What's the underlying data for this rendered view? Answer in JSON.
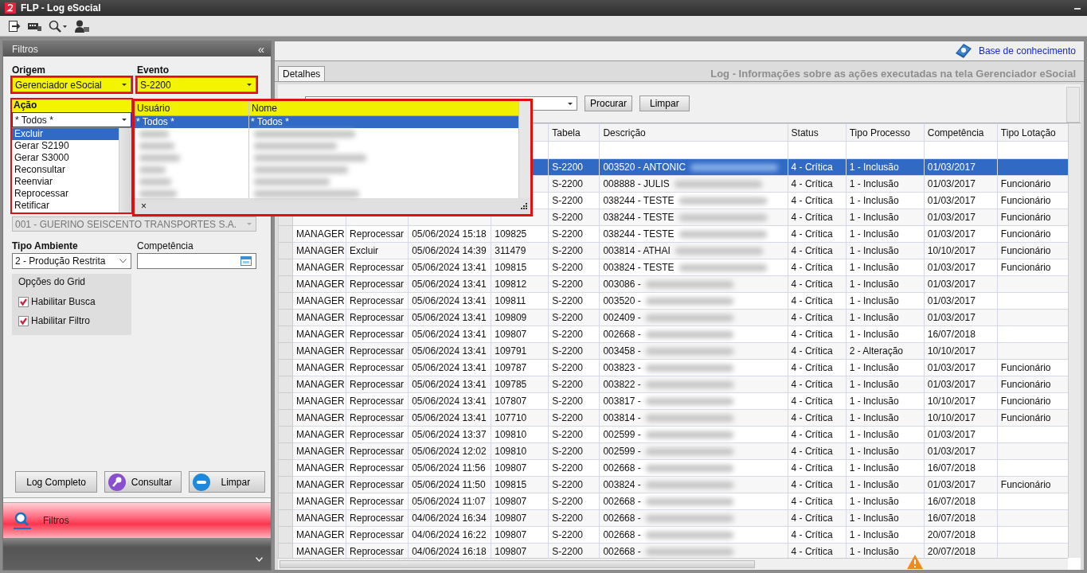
{
  "window": {
    "title": "FLP - Log eSocial"
  },
  "filters_panel": {
    "title": "Filtros",
    "collapse": "«",
    "origem": {
      "label": "Origem",
      "value": "Gerenciador eSocial",
      "highlighted": true
    },
    "evento": {
      "label": "Evento",
      "value": "S-2200",
      "highlighted": true
    },
    "acao": {
      "label": "Ação",
      "value": "* Todos *",
      "highlighted": true,
      "expanded": true,
      "options": [
        {
          "label": "Excluir",
          "selected": true
        },
        {
          "label": "Gerar S2190",
          "selected": false
        },
        {
          "label": "Gerar S3000",
          "selected": false
        },
        {
          "label": "Reconsultar",
          "selected": false
        },
        {
          "label": "Reenviar",
          "selected": false
        },
        {
          "label": "Reprocessar",
          "selected": false
        },
        {
          "label": "Retificar",
          "selected": false
        }
      ]
    },
    "empresa": {
      "value": "001 - GUERINO SEISCENTO TRANSPORTES S.A.",
      "disabled": true
    },
    "usuario_popup": {
      "highlighted": true,
      "columns": [
        "Usuário",
        "Nome"
      ],
      "rows": [
        {
          "usuario": "* Todos *",
          "nome": "* Todos *",
          "selected": true
        }
      ],
      "clear": "×"
    },
    "tipo_ambiente": {
      "label": "Tipo Ambiente",
      "value": "2 - Produção Restrita"
    },
    "competencia": {
      "label": "Competência"
    },
    "grid_options": {
      "title": "Opções do Grid",
      "options": [
        {
          "label": "Habilitar Busca",
          "checked": true
        },
        {
          "label": "Habilitar Filtro",
          "checked": true
        }
      ]
    },
    "buttons": [
      "Log Completo",
      "Consultar",
      "Limpar"
    ]
  },
  "nav": {
    "label": "Filtros",
    "selected": true
  },
  "help_link": "Base de conhecimento",
  "tabs": [
    {
      "label": "Detalhes",
      "selected": true
    }
  ],
  "page_title": "Log - Informações sobre as ações executadas na tela Gerenciador eSocial",
  "search": {
    "buttons": [
      "Procurar",
      "Limpar"
    ]
  },
  "table": {
    "columns": [
      "Tabela",
      "Descrição",
      "Status",
      "Tipo Processo",
      "Competência",
      "Tipo Lotação"
    ],
    "rows": [
      {
        "selected": true,
        "blurred": true,
        "tabela": "S-2200",
        "descricao": "003520 - ANTONIC",
        "status": "4 - Crítica",
        "tipo_processo": "1 - Inclusão",
        "competencia": "01/03/2017"
      },
      {
        "selected": false,
        "blurred": true,
        "tabela": "S-2200",
        "descricao": "008888 - JULIS",
        "status": "4 - Crítica",
        "tipo_processo": "1 - Inclusão",
        "competencia": "01/03/2017",
        "tipo_lotacao": "Funcionário"
      },
      {
        "selected": false,
        "blurred": true,
        "tabela": "S-2200",
        "descricao": "038244 - TESTE",
        "status": "4 - Crítica",
        "tipo_processo": "1 - Inclusão",
        "competencia": "01/03/2017",
        "tipo_lotacao": "Funcionário"
      },
      {
        "selected": false,
        "blurred": true,
        "tabela": "S-2200",
        "descricao": "038244 - TESTE",
        "status": "4 - Crítica",
        "tipo_processo": "1 - Inclusão",
        "competencia": "01/03/2017",
        "tipo_lotacao": "Funcionário"
      },
      {
        "selected": false,
        "blurred": true,
        "column_1": "MANAGER",
        "column_2": "Reprocessar",
        "column_3": "05/06/2024 15:18",
        "column_4": "109825",
        "tabela": "S-2200",
        "descricao": "038244 - TESTE",
        "status": "4 - Crítica",
        "tipo_processo": "1 - Inclusão",
        "competencia": "01/03/2017",
        "tipo_lotacao": "Funcionário"
      },
      {
        "selected": false,
        "blurred": true,
        "column_1": "MANAGER",
        "column_2": "Excluir",
        "column_3": "05/06/2024 14:39",
        "column_4": "311479",
        "tabela": "S-2200",
        "descricao": "003814 - ATHAI",
        "status": "4 - Crítica",
        "tipo_processo": "1 - Inclusão",
        "competencia": "10/10/2017",
        "tipo_lotacao": "Funcionário"
      },
      {
        "selected": false,
        "blurred": true,
        "column_1": "MANAGER",
        "column_2": "Reprocessar",
        "column_3": "05/06/2024 13:41",
        "column_4": "109815",
        "tabela": "S-2200",
        "descricao": "003824 - TESTE",
        "status": "4 - Crítica",
        "tipo_processo": "1 - Inclusão",
        "competencia": "01/03/2017",
        "tipo_lotacao": "Funcionário"
      },
      {
        "selected": false,
        "blurred": true,
        "column_1": "MANAGER",
        "column_2": "Reprocessar",
        "column_3": "05/06/2024 13:41",
        "column_4": "109812",
        "tabela": "S-2200",
        "descricao": "003086 -",
        "status": "4 - Crítica",
        "tipo_processo": "1 - Inclusão",
        "competencia": "01/03/2017"
      },
      {
        "selected": false,
        "blurred": true,
        "column_1": "MANAGER",
        "column_2": "Reprocessar",
        "column_3": "05/06/2024 13:41",
        "column_4": "109811",
        "tabela": "S-2200",
        "descricao": "003520 -",
        "status": "4 - Crítica",
        "tipo_processo": "1 - Inclusão",
        "competencia": "01/03/2017"
      },
      {
        "selected": false,
        "blurred": true,
        "column_1": "MANAGER",
        "column_2": "Reprocessar",
        "column_3": "05/06/2024 13:41",
        "column_4": "109809",
        "tabela": "S-2200",
        "descricao": "002409 -",
        "status": "4 - Crítica",
        "tipo_processo": "1 - Inclusão",
        "competencia": "01/03/2017"
      },
      {
        "selected": false,
        "blurred": true,
        "column_1": "MANAGER",
        "column_2": "Reprocessar",
        "column_3": "05/06/2024 13:41",
        "column_4": "109807",
        "tabela": "S-2200",
        "descricao": "002668 -",
        "status": "4 - Crítica",
        "tipo_processo": "1 - Inclusão",
        "competencia": "16/07/2018"
      },
      {
        "selected": false,
        "blurred": true,
        "column_1": "MANAGER",
        "column_2": "Reprocessar",
        "column_3": "05/06/2024 13:41",
        "column_4": "109791",
        "tabela": "S-2200",
        "descricao": "003458 -",
        "status": "4 - Crítica",
        "tipo_processo": "2 - Alteração",
        "competencia": "10/10/2017"
      },
      {
        "selected": false,
        "blurred": true,
        "column_1": "MANAGER",
        "column_2": "Reprocessar",
        "column_3": "05/06/2024 13:41",
        "column_4": "109787",
        "tabela": "S-2200",
        "descricao": "003823 -",
        "status": "4 - Crítica",
        "tipo_processo": "1 - Inclusão",
        "competencia": "01/03/2017",
        "tipo_lotacao": "Funcionário"
      },
      {
        "selected": false,
        "blurred": true,
        "column_1": "MANAGER",
        "column_2": "Reprocessar",
        "column_3": "05/06/2024 13:41",
        "column_4": "109785",
        "tabela": "S-2200",
        "descricao": "003822 -",
        "status": "4 - Crítica",
        "tipo_processo": "1 - Inclusão",
        "competencia": "01/03/2017",
        "tipo_lotacao": "Funcionário"
      },
      {
        "selected": false,
        "blurred": true,
        "column_1": "MANAGER",
        "column_2": "Reprocessar",
        "column_3": "05/06/2024 13:41",
        "column_4": "107807",
        "tabela": "S-2200",
        "descricao": "003817 -",
        "status": "4 - Crítica",
        "tipo_processo": "1 - Inclusão",
        "competencia": "10/10/2017",
        "tipo_lotacao": "Funcionário"
      },
      {
        "selected": false,
        "blurred": true,
        "column_1": "MANAGER",
        "column_2": "Reprocessar",
        "column_3": "05/06/2024 13:41",
        "column_4": "107710",
        "tabela": "S-2200",
        "descricao": "003814 -",
        "status": "4 - Crítica",
        "tipo_processo": "1 - Inclusão",
        "competencia": "10/10/2017",
        "tipo_lotacao": "Funcionário"
      },
      {
        "selected": false,
        "blurred": true,
        "column_1": "MANAGER",
        "column_2": "Reprocessar",
        "column_3": "05/06/2024 13:37",
        "column_4": "109810",
        "tabela": "S-2200",
        "descricao": "002599 -",
        "status": "4 - Crítica",
        "tipo_processo": "1 - Inclusão",
        "competencia": "01/03/2017"
      },
      {
        "selected": false,
        "blurred": true,
        "column_1": "MANAGER",
        "column_2": "Reprocessar",
        "column_3": "05/06/2024 12:02",
        "column_4": "109810",
        "tabela": "S-2200",
        "descricao": "002599 -",
        "status": "4 - Crítica",
        "tipo_processo": "1 - Inclusão",
        "competencia": "01/03/2017"
      },
      {
        "selected": false,
        "blurred": true,
        "column_1": "MANAGER",
        "column_2": "Reprocessar",
        "column_3": "05/06/2024 11:56",
        "column_4": "109807",
        "tabela": "S-2200",
        "descricao": "002668 -",
        "status": "4 - Crítica",
        "tipo_processo": "1 - Inclusão",
        "competencia": "16/07/2018"
      },
      {
        "selected": false,
        "blurred": true,
        "column_1": "MANAGER",
        "column_2": "Reprocessar",
        "column_3": "05/06/2024 11:50",
        "column_4": "109815",
        "tabela": "S-2200",
        "descricao": "003824 -",
        "status": "4 - Crítica",
        "tipo_processo": "1 - Inclusão",
        "competencia": "01/03/2017",
        "tipo_lotacao": "Funcionário"
      },
      {
        "selected": false,
        "blurred": true,
        "column_1": "MANAGER",
        "column_2": "Reprocessar",
        "column_3": "05/06/2024 11:07",
        "column_4": "109807",
        "tabela": "S-2200",
        "descricao": "002668 -",
        "status": "4 - Crítica",
        "tipo_processo": "1 - Inclusão",
        "competencia": "16/07/2018"
      },
      {
        "selected": false,
        "blurred": true,
        "column_1": "MANAGER",
        "column_2": "Reprocessar",
        "column_3": "04/06/2024 16:34",
        "column_4": "109807",
        "tabela": "S-2200",
        "descricao": "002668 -",
        "status": "4 - Crítica",
        "tipo_processo": "1 - Inclusão",
        "competencia": "16/07/2018"
      },
      {
        "selected": false,
        "blurred": true,
        "column_1": "MANAGER",
        "column_2": "Reprocessar",
        "column_3": "04/06/2024 16:22",
        "column_4": "109807",
        "tabela": "S-2200",
        "descricao": "002668 -",
        "status": "4 - Crítica",
        "tipo_processo": "1 - Inclusão",
        "competencia": "20/07/2018"
      },
      {
        "selected": false,
        "blurred": true,
        "column_1": "MANAGER",
        "column_2": "Reprocessar",
        "column_3": "04/06/2024 16:18",
        "column_4": "109807",
        "tabela": "S-2200",
        "descricao": "002668 -",
        "status": "4 - Crítica",
        "tipo_processo": "1 - Inclusão",
        "competencia": "20/07/2018"
      }
    ]
  }
}
